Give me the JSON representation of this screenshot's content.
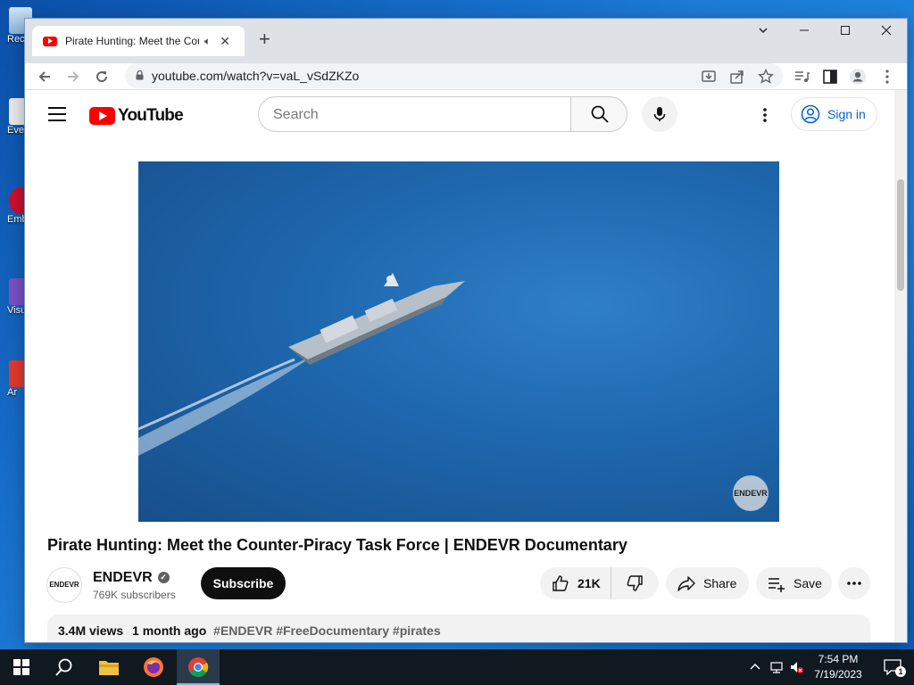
{
  "desktop": {
    "icons": [
      {
        "label": "Rec"
      },
      {
        "label": "Eve"
      },
      {
        "label": "Emb De"
      },
      {
        "label": "Visu"
      },
      {
        "label": "Ar"
      }
    ]
  },
  "browser": {
    "tab_title": "Pirate Hunting: Meet the Cou",
    "url": "youtube.com/watch?v=vaL_vSdZKZo"
  },
  "youtube": {
    "logo_text": "YouTube",
    "search_placeholder": "Search",
    "sign_in_label": "Sign in",
    "video": {
      "title": "Pirate Hunting: Meet the Counter-Piracy Task Force | ENDEVR Documentary",
      "watermark": "ENDEVR"
    },
    "channel": {
      "avatar_text": "ENDEVR",
      "name": "ENDEVR",
      "subscribers": "769K subscribers",
      "subscribe_label": "Subscribe"
    },
    "actions": {
      "likes": "21K",
      "share_label": "Share",
      "save_label": "Save"
    },
    "description": {
      "views": "3.4M views",
      "age": "1 month ago",
      "tags": "#ENDEVR #FreeDocumentary #pirates"
    }
  },
  "taskbar": {
    "time": "7:54 PM",
    "date": "7/19/2023",
    "notification_count": "1"
  },
  "colors": {
    "youtube_red": "#ff0000",
    "link_blue": "#065fd4",
    "taskbar": "#101820"
  }
}
